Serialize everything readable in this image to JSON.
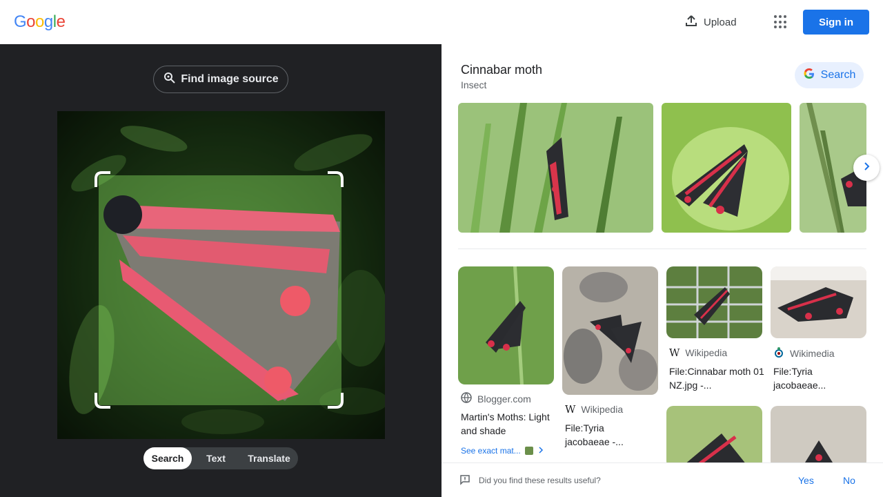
{
  "header": {
    "logo": "Google",
    "upload_label": "Upload",
    "signin_label": "Sign in"
  },
  "left_panel": {
    "find_source_label": "Find image source",
    "tabs": [
      {
        "label": "Search",
        "active": true
      },
      {
        "label": "Text",
        "active": false
      },
      {
        "label": "Translate",
        "active": false
      }
    ]
  },
  "knowledge_panel": {
    "title": "Cinnabar moth",
    "subtitle": "Insect",
    "search_label": "Search"
  },
  "results": [
    {
      "source": "Blogger.com",
      "title": "Martin's Moths: Light and shade",
      "source_icon": "globe-icon"
    },
    {
      "source": "Wikipedia",
      "title": "File:Tyria jacobaeae -...",
      "source_icon": "wikipedia-icon"
    },
    {
      "source": "Wikipedia",
      "title": "File:Cinnabar moth 01 NZ.jpg -...",
      "source_icon": "wikipedia-icon"
    },
    {
      "source": "Wikimedia",
      "title": "File:Tyria jacobaeae...",
      "source_icon": "wikimedia-icon"
    }
  ],
  "exact_match_label": "See exact mat...",
  "feedback": {
    "question": "Did you find these results useful?",
    "yes": "Yes",
    "no": "No"
  },
  "colors": {
    "accent": "#1a73e8",
    "dark_panel": "#202124"
  }
}
